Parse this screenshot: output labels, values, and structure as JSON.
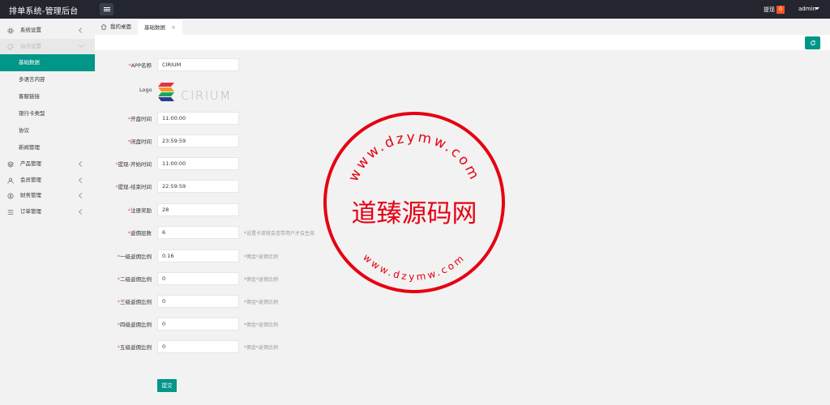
{
  "header": {
    "title": "排单系统-管理后台",
    "withdraw_label": "提现",
    "withdraw_count": "0",
    "user": "admin"
  },
  "sidebar": {
    "items": [
      {
        "label": "系统设置",
        "icon": "gear-icon"
      },
      {
        "label": "站点设置",
        "icon": "palette-icon"
      },
      {
        "label": "产品管理",
        "icon": "layers-icon"
      },
      {
        "label": "会员管理",
        "icon": "user-icon"
      },
      {
        "label": "财务管理",
        "icon": "dollar-icon"
      },
      {
        "label": "订单管理",
        "icon": "list-icon"
      }
    ],
    "subitems": [
      "基础数据",
      "多语言内容",
      "客服链接",
      "银行卡类型",
      "协议",
      "新闻管理"
    ]
  },
  "tabs": {
    "home": "我的桌面",
    "current": "基础数据",
    "close_glyph": "×"
  },
  "form": {
    "app_name": {
      "label": "APP名称",
      "value": "CIRIUM"
    },
    "logo": {
      "label": "Logo",
      "text": "CIRIUM"
    },
    "open_time": {
      "label": "开盘时间",
      "value": "11:00:00"
    },
    "close_time": {
      "label": "闭盘时间",
      "value": "23:59:59"
    },
    "withdraw_start": {
      "label": "提现-开始时间",
      "value": "11:00:00"
    },
    "withdraw_end": {
      "label": "提现-结束时间",
      "value": "22:59:59"
    },
    "register_reward": {
      "label": "注册奖励",
      "value": "28"
    },
    "rebate_levels": {
      "label": "返佣层数",
      "value": "6",
      "hint": "设置卡单就会连带用户才会生效"
    },
    "level1": {
      "label": "一级返佣比例",
      "value": "0.16",
      "hint": "佣金*返佣比例"
    },
    "level2": {
      "label": "二级返佣比例",
      "value": "0",
      "hint": "佣金*返佣比例"
    },
    "level3": {
      "label": "三级返佣比例",
      "value": "0",
      "hint": "佣金*返佣比例"
    },
    "level4": {
      "label": "四级返佣比例",
      "value": "0",
      "hint": "佣金*返佣比例"
    },
    "level5": {
      "label": "五级返佣比例",
      "value": "0",
      "hint": "佣金*返佣比例"
    },
    "submit": "提交",
    "required_mark": "*"
  },
  "watermark": {
    "top_text": "www.dzymw.com",
    "center_text": "道臻源码网",
    "bottom_text": "www.dzymw.com",
    "color": "#e60012"
  },
  "colors": {
    "accent": "#009688",
    "header_bg": "#23262e",
    "badge": "#ff5722"
  }
}
